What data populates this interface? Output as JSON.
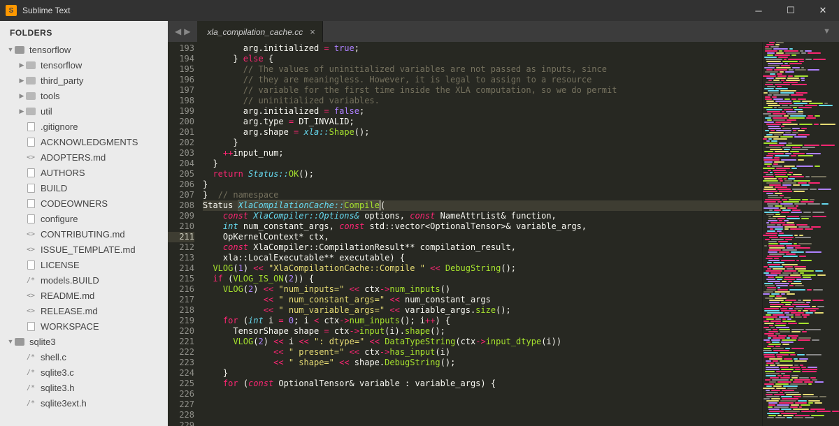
{
  "app": {
    "title": "Sublime Text"
  },
  "sidebar": {
    "title": "FOLDERS",
    "roots": [
      {
        "name": "tensorflow",
        "icon": "folder-open",
        "expanded": true,
        "children": [
          {
            "name": "tensorflow",
            "icon": "folder"
          },
          {
            "name": "third_party",
            "icon": "folder"
          },
          {
            "name": "tools",
            "icon": "folder"
          },
          {
            "name": "util",
            "icon": "folder"
          },
          {
            "name": ".gitignore",
            "icon": "file"
          },
          {
            "name": "ACKNOWLEDGMENTS",
            "icon": "file"
          },
          {
            "name": "ADOPTERS.md",
            "icon": "md"
          },
          {
            "name": "AUTHORS",
            "icon": "file"
          },
          {
            "name": "BUILD",
            "icon": "file"
          },
          {
            "name": "CODEOWNERS",
            "icon": "file"
          },
          {
            "name": "configure",
            "icon": "file"
          },
          {
            "name": "CONTRIBUTING.md",
            "icon": "md"
          },
          {
            "name": "ISSUE_TEMPLATE.md",
            "icon": "md"
          },
          {
            "name": "LICENSE",
            "icon": "file"
          },
          {
            "name": "models.BUILD",
            "icon": "code"
          },
          {
            "name": "README.md",
            "icon": "md"
          },
          {
            "name": "RELEASE.md",
            "icon": "md"
          },
          {
            "name": "WORKSPACE",
            "icon": "file"
          }
        ]
      },
      {
        "name": "sqlite3",
        "icon": "folder-open",
        "expanded": true,
        "children": [
          {
            "name": "shell.c",
            "icon": "code"
          },
          {
            "name": "sqlite3.c",
            "icon": "code"
          },
          {
            "name": "sqlite3.h",
            "icon": "code"
          },
          {
            "name": "sqlite3ext.h",
            "icon": "code"
          }
        ]
      }
    ]
  },
  "tab": {
    "name": "xla_compilation_cache.cc"
  },
  "editor": {
    "first_line": 193,
    "highlight_line": 211,
    "lines": [
      [
        [
          "        arg.initialized ",
          "p"
        ],
        [
          "= ",
          "o"
        ],
        [
          "true",
          "n"
        ],
        [
          ";",
          "p"
        ]
      ],
      [
        [
          "      } ",
          "p"
        ],
        [
          "else",
          "k"
        ],
        [
          " {",
          "p"
        ]
      ],
      [
        [
          "        ",
          "p"
        ],
        [
          "// The values of uninitialized variables are not passed as inputs, since",
          "c"
        ]
      ],
      [
        [
          "        ",
          "p"
        ],
        [
          "// they are meaningless. However, it is legal to assign to a resource",
          "c"
        ]
      ],
      [
        [
          "        ",
          "p"
        ],
        [
          "// variable for the first time inside the XLA computation, so we do permit",
          "c"
        ]
      ],
      [
        [
          "        ",
          "p"
        ],
        [
          "// uninitialized variables.",
          "c"
        ]
      ],
      [
        [
          "        arg.initialized ",
          "p"
        ],
        [
          "= ",
          "o"
        ],
        [
          "false",
          "n"
        ],
        [
          ";",
          "p"
        ]
      ],
      [
        [
          "        arg.type ",
          "p"
        ],
        [
          "=",
          "o"
        ],
        [
          " DT_INVALID;",
          "p"
        ]
      ],
      [
        [
          "        arg.shape ",
          "p"
        ],
        [
          "=",
          "o"
        ],
        [
          " ",
          "p"
        ],
        [
          "xla::",
          "t"
        ],
        [
          "Shape",
          "f"
        ],
        [
          "();",
          "p"
        ]
      ],
      [
        [
          "      }",
          "p"
        ]
      ],
      [
        [
          "    ",
          "p"
        ],
        [
          "++",
          "o"
        ],
        [
          "input_num;",
          "p"
        ]
      ],
      [
        [
          "  }",
          "p"
        ]
      ],
      [
        [
          "",
          "p"
        ]
      ],
      [
        [
          "  ",
          "p"
        ],
        [
          "return",
          "k"
        ],
        [
          " ",
          "p"
        ],
        [
          "Status::",
          "t"
        ],
        [
          "OK",
          "f"
        ],
        [
          "();",
          "p"
        ]
      ],
      [
        [
          "}",
          "p"
        ]
      ],
      [
        [
          "",
          "p"
        ]
      ],
      [
        [
          "}  ",
          "p"
        ],
        [
          "// namespace",
          "c"
        ]
      ],
      [
        [
          "",
          "p"
        ]
      ],
      [
        [
          "Status ",
          "p"
        ],
        [
          "XlaCompilationCache::",
          "fnhl-t"
        ],
        [
          "Compile",
          "fnhl-f"
        ],
        [
          "(",
          "p"
        ]
      ],
      [
        [
          "    ",
          "p"
        ],
        [
          "const",
          "kf"
        ],
        [
          " ",
          "p"
        ],
        [
          "XlaCompiler::Options&",
          "t"
        ],
        [
          " options, ",
          "p"
        ],
        [
          "const",
          "kf"
        ],
        [
          " ",
          "p"
        ],
        [
          "NameAttrList&",
          "p"
        ],
        [
          " function,",
          "p"
        ]
      ],
      [
        [
          "    ",
          "p"
        ],
        [
          "int",
          "t"
        ],
        [
          " num_constant_args, ",
          "p"
        ],
        [
          "const",
          "kf"
        ],
        [
          " ",
          "p"
        ],
        [
          "std::vector<OptionalTensor>&",
          "p"
        ],
        [
          " variable_args,",
          "p"
        ]
      ],
      [
        [
          "    ",
          "p"
        ],
        [
          "OpKernelContext*",
          "p"
        ],
        [
          " ctx,",
          "p"
        ]
      ],
      [
        [
          "    ",
          "p"
        ],
        [
          "const",
          "kf"
        ],
        [
          " ",
          "p"
        ],
        [
          "XlaCompiler::CompilationResult**",
          "p"
        ],
        [
          " compilation_result,",
          "p"
        ]
      ],
      [
        [
          "    ",
          "p"
        ],
        [
          "xla::LocalExecutable**",
          "p"
        ],
        [
          " executable) {",
          "p"
        ]
      ],
      [
        [
          "  ",
          "p"
        ],
        [
          "VLOG",
          "f"
        ],
        [
          "(",
          "p"
        ],
        [
          "1",
          "n"
        ],
        [
          ") ",
          "p"
        ],
        [
          "<<",
          "o"
        ],
        [
          " ",
          "p"
        ],
        [
          "\"XlaCompilationCache::Compile \"",
          "s"
        ],
        [
          " ",
          "p"
        ],
        [
          "<<",
          "o"
        ],
        [
          " ",
          "p"
        ],
        [
          "DebugString",
          "f"
        ],
        [
          "();",
          "p"
        ]
      ],
      [
        [
          "",
          "p"
        ]
      ],
      [
        [
          "  ",
          "p"
        ],
        [
          "if",
          "k"
        ],
        [
          " (",
          "p"
        ],
        [
          "VLOG_IS_ON",
          "f"
        ],
        [
          "(",
          "p"
        ],
        [
          "2",
          "n"
        ],
        [
          ")) {",
          "p"
        ]
      ],
      [
        [
          "    ",
          "p"
        ],
        [
          "VLOG",
          "f"
        ],
        [
          "(",
          "p"
        ],
        [
          "2",
          "n"
        ],
        [
          ") ",
          "p"
        ],
        [
          "<<",
          "o"
        ],
        [
          " ",
          "p"
        ],
        [
          "\"num_inputs=\"",
          "s"
        ],
        [
          " ",
          "p"
        ],
        [
          "<<",
          "o"
        ],
        [
          " ctx",
          "p"
        ],
        [
          "->",
          "o"
        ],
        [
          "num_inputs",
          "f"
        ],
        [
          "()",
          "p"
        ]
      ],
      [
        [
          "            ",
          "p"
        ],
        [
          "<<",
          "o"
        ],
        [
          " ",
          "p"
        ],
        [
          "\" num_constant_args=\"",
          "s"
        ],
        [
          " ",
          "p"
        ],
        [
          "<<",
          "o"
        ],
        [
          " num_constant_args",
          "p"
        ]
      ],
      [
        [
          "            ",
          "p"
        ],
        [
          "<<",
          "o"
        ],
        [
          " ",
          "p"
        ],
        [
          "\" num_variable_args=\"",
          "s"
        ],
        [
          " ",
          "p"
        ],
        [
          "<<",
          "o"
        ],
        [
          " variable_args.",
          "p"
        ],
        [
          "size",
          "f"
        ],
        [
          "();",
          "p"
        ]
      ],
      [
        [
          "    ",
          "p"
        ],
        [
          "for",
          "k"
        ],
        [
          " (",
          "p"
        ],
        [
          "int",
          "t"
        ],
        [
          " i ",
          "p"
        ],
        [
          "=",
          "o"
        ],
        [
          " ",
          "p"
        ],
        [
          "0",
          "n"
        ],
        [
          "; i ",
          "p"
        ],
        [
          "<",
          "o"
        ],
        [
          " ctx",
          "p"
        ],
        [
          "->",
          "o"
        ],
        [
          "num_inputs",
          "f"
        ],
        [
          "(); i",
          "p"
        ],
        [
          "++",
          "o"
        ],
        [
          ") {",
          "p"
        ]
      ],
      [
        [
          "      TensorShape shape ",
          "p"
        ],
        [
          "=",
          "o"
        ],
        [
          " ctx",
          "p"
        ],
        [
          "->",
          "o"
        ],
        [
          "input",
          "f"
        ],
        [
          "(i).",
          "p"
        ],
        [
          "shape",
          "f"
        ],
        [
          "();",
          "p"
        ]
      ],
      [
        [
          "      ",
          "p"
        ],
        [
          "VLOG",
          "f"
        ],
        [
          "(",
          "p"
        ],
        [
          "2",
          "n"
        ],
        [
          ") ",
          "p"
        ],
        [
          "<<",
          "o"
        ],
        [
          " i ",
          "p"
        ],
        [
          "<<",
          "o"
        ],
        [
          " ",
          "p"
        ],
        [
          "\": dtype=\"",
          "s"
        ],
        [
          " ",
          "p"
        ],
        [
          "<<",
          "o"
        ],
        [
          " ",
          "p"
        ],
        [
          "DataTypeString",
          "f"
        ],
        [
          "(ctx",
          "p"
        ],
        [
          "->",
          "o"
        ],
        [
          "input_dtype",
          "f"
        ],
        [
          "(i))",
          "p"
        ]
      ],
      [
        [
          "              ",
          "p"
        ],
        [
          "<<",
          "o"
        ],
        [
          " ",
          "p"
        ],
        [
          "\" present=\"",
          "s"
        ],
        [
          " ",
          "p"
        ],
        [
          "<<",
          "o"
        ],
        [
          " ctx",
          "p"
        ],
        [
          "->",
          "o"
        ],
        [
          "has_input",
          "f"
        ],
        [
          "(i)",
          "p"
        ]
      ],
      [
        [
          "              ",
          "p"
        ],
        [
          "<<",
          "o"
        ],
        [
          " ",
          "p"
        ],
        [
          "\" shape=\"",
          "s"
        ],
        [
          " ",
          "p"
        ],
        [
          "<<",
          "o"
        ],
        [
          " shape.",
          "p"
        ],
        [
          "DebugString",
          "f"
        ],
        [
          "();",
          "p"
        ]
      ],
      [
        [
          "    }",
          "p"
        ]
      ],
      [
        [
          "    ",
          "p"
        ],
        [
          "for",
          "k"
        ],
        [
          " (",
          "p"
        ],
        [
          "const",
          "kf"
        ],
        [
          " ",
          "p"
        ],
        [
          "OptionalTensor&",
          "p"
        ],
        [
          " variable : variable_args) {",
          "p"
        ]
      ]
    ]
  }
}
